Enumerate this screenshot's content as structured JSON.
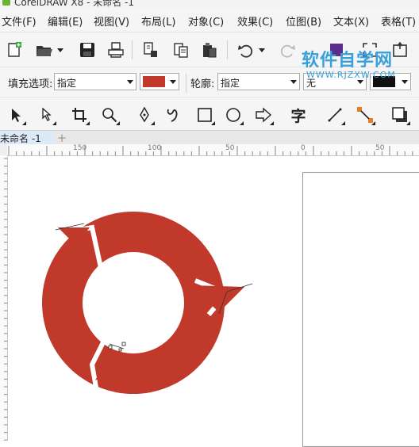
{
  "app": {
    "title": "CorelDRAW X8 - 未命名 -1"
  },
  "menu": [
    "文件(F)",
    "编辑(E)",
    "视图(V)",
    "布局(L)",
    "对象(C)",
    "效果(C)",
    "位图(B)",
    "文本(X)",
    "表格(T)"
  ],
  "toolbar": {
    "icons": [
      "new-document-icon",
      "open-folder-icon",
      "save-icon",
      "print-icon",
      "import-icon",
      "export-icon",
      "paste-icon",
      "undo-icon",
      "redo-icon"
    ]
  },
  "property_bar": {
    "fill_label": "填充选项:",
    "fill_value": "指定",
    "fill_color": "#c0392b",
    "outline_label": "轮廓:",
    "outline_value": "指定",
    "outline_style_value": "无",
    "outline_color": "#111111"
  },
  "toolbox": {
    "icons": [
      "pick-tool-icon",
      "shape-tool-icon",
      "crop-tool-icon",
      "zoom-tool-icon",
      "pen-tool-icon",
      "artistic-media-icon",
      "rectangle-tool-icon",
      "ellipse-tool-icon",
      "arrow-shape-icon",
      "text-tool-icon",
      "connector-tool-icon",
      "dimension-tool-icon",
      "drop-shadow-tool-icon"
    ],
    "text_tool_glyph": "字"
  },
  "document_tab": {
    "label": "未命名 -1",
    "add_label": "+"
  },
  "ruler": {
    "labels": [
      "150",
      "100",
      "50",
      "0",
      "50"
    ]
  },
  "watermark": {
    "main": "软件自学网",
    "sub": "WWW.RJZXW.COM"
  },
  "canvas": {
    "ring_color": "#c0392b",
    "page_color": "#ffffff"
  }
}
